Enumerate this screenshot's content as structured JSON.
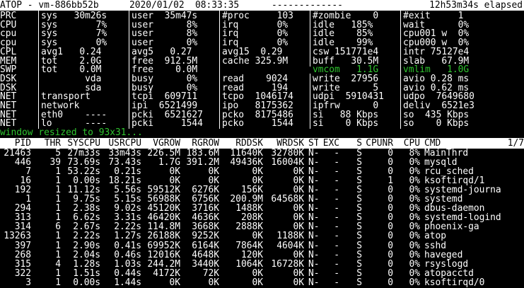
{
  "header": {
    "title": "ATOP - vm-886bb52b",
    "date": "2020/01/02",
    "time": "08:33:35",
    "dashes": "-------------",
    "elapsed": "12h53m34s elapsed"
  },
  "summary": [
    {
      "label": "PRC",
      "cells": [
        "sys   30m26s",
        "user  35m47s",
        "#proc     103",
        "#zombie    0",
        "#exit     1"
      ]
    },
    {
      "label": "CPU",
      "cells": [
        "sys       7%",
        "user      8%",
        "irq       0%",
        "idle   185%",
        "wait      0%"
      ]
    },
    {
      "label": "cpu",
      "cells": [
        "sys       7%",
        "user      8%",
        "irq       0%",
        "idle    85%",
        "cpu001 w  0%"
      ]
    },
    {
      "label": "cpu",
      "cells": [
        "sys       0%",
        "user      0%",
        "irq       0%",
        "idle    99%",
        "cpu000 w  0%"
      ]
    },
    {
      "label": "CPL",
      "cells": [
        "avg1   0.24",
        "avg5   0.27",
        "avg15  0.29",
        "csw 151771e4",
        "intr 75127e4"
      ]
    },
    {
      "label": "MEM",
      "cells": [
        "tot    2.0G",
        "free  912.5M",
        "cache 325.9M",
        "buff   30.5M",
        "slab   67.9M"
      ]
    },
    {
      "label": "SWP",
      "cells": [
        "tot    0.0M",
        "free    0.0M",
        "",
        "vmcom   1.1G",
        "vmlim   1.0G"
      ],
      "green": [
        3,
        4
      ]
    },
    {
      "label": "DSK",
      "cells": [
        "        vda",
        "busy      0%",
        "read    9024",
        "write  27956",
        "avio 0.28 ms"
      ]
    },
    {
      "label": "DSK",
      "cells": [
        "        sda",
        "busy      0%",
        "read     194",
        "write      5",
        "avio 0.62 ms"
      ]
    },
    {
      "label": "NET",
      "cells": [
        "transport",
        "tcpi  609711",
        "tcpo  1046174",
        "udpi  5910431",
        "udpo  7649680"
      ]
    },
    {
      "label": "NET",
      "cells": [
        "network",
        "ipi  6521499",
        "ipo   8175362",
        "ipfrw      0",
        "deliv  6521e3"
      ]
    },
    {
      "label": "NET",
      "cells": [
        "eth0    ----",
        "pcki  6521627",
        "pcko  8175486",
        "si   88 Kbps",
        "so  435 Kbps"
      ]
    },
    {
      "label": "NET",
      "cells": [
        "lo      ----",
        "pcki     1544",
        "pcko     1544",
        "si    0 Kbps",
        "so    0 Kbps"
      ]
    }
  ],
  "message": "window resized to 93x31...",
  "process_table": {
    "columns": [
      "PID",
      "THR",
      "SYSCPU",
      "USRCPU",
      "VGROW",
      "RGROW",
      "RDDSK",
      "WRDSK",
      "ST",
      "EXC",
      "S",
      "CPUNR",
      "CPU",
      "CMD"
    ],
    "page": "1/7",
    "rows": [
      [
        "21463",
        "5",
        "27m33s",
        "33m43s",
        "226.5M",
        "183.6M",
        "11640K",
        "32780K",
        "N-",
        "-",
        "S",
        "0",
        "8%",
        "MainThrd"
      ],
      [
        "446",
        "39",
        "73.69s",
        "73.43s",
        "1.7G",
        "391.2M",
        "49436K",
        "16004K",
        "N-",
        "-",
        "S",
        "0",
        "0%",
        "mysqld"
      ],
      [
        "7",
        "1",
        "53.22s",
        "0.21s",
        "0K",
        "0K",
        "0K",
        "0K",
        "N-",
        "-",
        "S",
        "0",
        "0%",
        "rcu_sched"
      ],
      [
        "16",
        "1",
        "0.00s",
        "18.21s",
        "0K",
        "0K",
        "0K",
        "0K",
        "N-",
        "-",
        "S",
        "1",
        "0%",
        "ksoftirqd/1"
      ],
      [
        "192",
        "1",
        "11.12s",
        "5.56s",
        "59512K",
        "6276K",
        "156K",
        "0K",
        "N-",
        "-",
        "S",
        "0",
        "0%",
        "systemd-journa"
      ],
      [
        "1",
        "1",
        "9.75s",
        "5.15s",
        "56988K",
        "6756K",
        "200.9M",
        "64568K",
        "N-",
        "-",
        "S",
        "0",
        "0%",
        "systemd"
      ],
      [
        "294",
        "1",
        "2.38s",
        "9.02s",
        "45120K",
        "3716K",
        "1488K",
        "0K",
        "N-",
        "-",
        "S",
        "0",
        "0%",
        "dbus-daemon"
      ],
      [
        "313",
        "1",
        "6.62s",
        "3.31s",
        "46420K",
        "4636K",
        "208K",
        "0K",
        "N-",
        "-",
        "S",
        "0",
        "0%",
        "systemd-logind"
      ],
      [
        "314",
        "6",
        "2.67s",
        "2.22s",
        "114.8M",
        "3668K",
        "2888K",
        "0K",
        "N-",
        "-",
        "S",
        "0",
        "0%",
        "phoenix-ga"
      ],
      [
        "13263",
        "1",
        "2.22s",
        "1.27s",
        "26188K",
        "9252K",
        "0K",
        "1188K",
        "N-",
        "-",
        "S",
        "0",
        "0%",
        "atop"
      ],
      [
        "397",
        "1",
        "2.90s",
        "0.41s",
        "69952K",
        "6164K",
        "7864K",
        "4604K",
        "N-",
        "-",
        "S",
        "0",
        "0%",
        "sshd"
      ],
      [
        "268",
        "1",
        "2.04s",
        "0.46s",
        "12016K",
        "4648K",
        "120K",
        "0K",
        "N-",
        "-",
        "S",
        "0",
        "0%",
        "haveged"
      ],
      [
        "315",
        "4",
        "1.28s",
        "1.03s",
        "244.2M",
        "3440K",
        "1064K",
        "16728K",
        "N-",
        "-",
        "S",
        "0",
        "0%",
        "rsyslogd"
      ],
      [
        "322",
        "1",
        "1.51s",
        "0.44s",
        "4172K",
        "72K",
        "0K",
        "0K",
        "N-",
        "-",
        "S",
        "0",
        "0%",
        "atopacctd"
      ],
      [
        "3",
        "1",
        "0.00s",
        "1.44s",
        "0K",
        "0K",
        "0K",
        "0K",
        "N-",
        "-",
        "S",
        "0",
        "0%",
        "ksoftirqd/0"
      ]
    ]
  },
  "colors": {
    "background": "#000000",
    "text": "#ffffff",
    "highlight": "#2ec52e",
    "header_bg": "#ffffff"
  }
}
